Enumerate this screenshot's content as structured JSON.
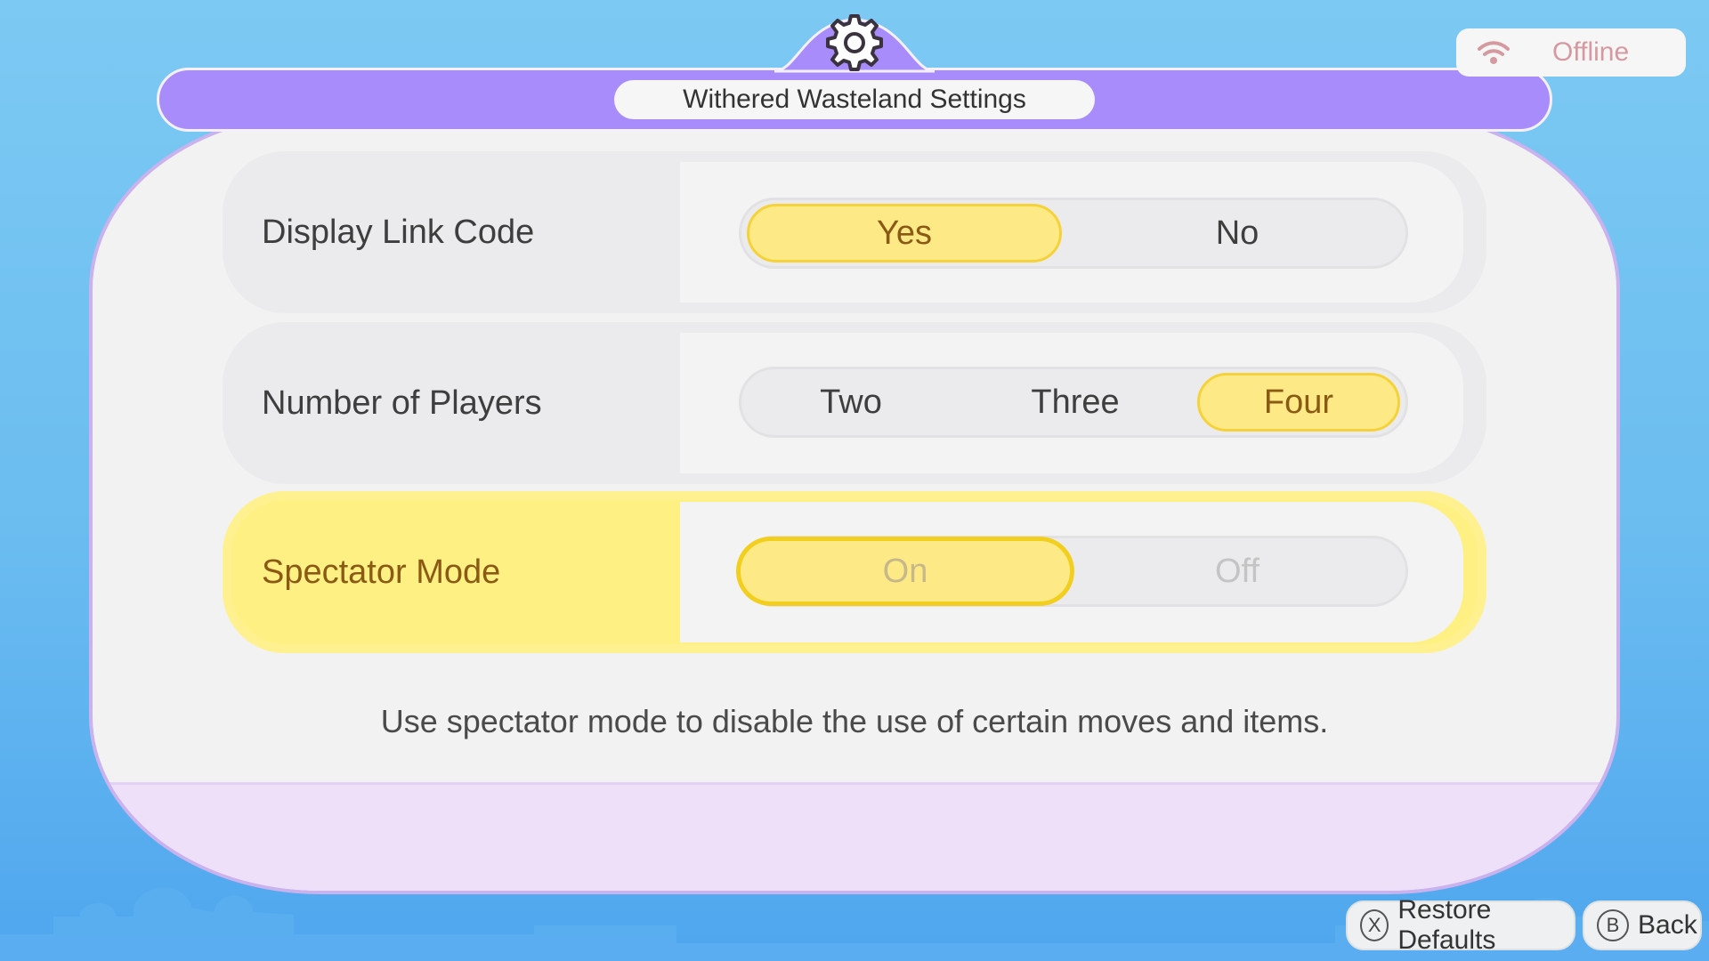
{
  "header": {
    "title": "Withered Wasteland Settings",
    "icon": "gear-icon"
  },
  "status": {
    "label": "Offline",
    "icon": "wifi-icon"
  },
  "settings": [
    {
      "label": "Display Link Code",
      "options": [
        "Yes",
        "No"
      ],
      "selected": "Yes"
    },
    {
      "label": "Number of Players",
      "options": [
        "Two",
        "Three",
        "Four"
      ],
      "selected": "Four"
    },
    {
      "label": "Spectator Mode",
      "options": [
        "On",
        "Off"
      ],
      "selected": "On",
      "focused": true
    }
  ],
  "description": "Use spectator mode to disable the use of certain moves and items.",
  "controls": {
    "restore": {
      "glyph": "X",
      "label": "Restore Defaults"
    },
    "back": {
      "glyph": "B",
      "label": "Back"
    }
  },
  "colors": {
    "header_purple": "#a88cfb",
    "selected_yellow": "#fdea86",
    "focus_yellow": "#fff084",
    "footer_lavender": "#efe0fa",
    "offline_text": "#d49aa0"
  }
}
